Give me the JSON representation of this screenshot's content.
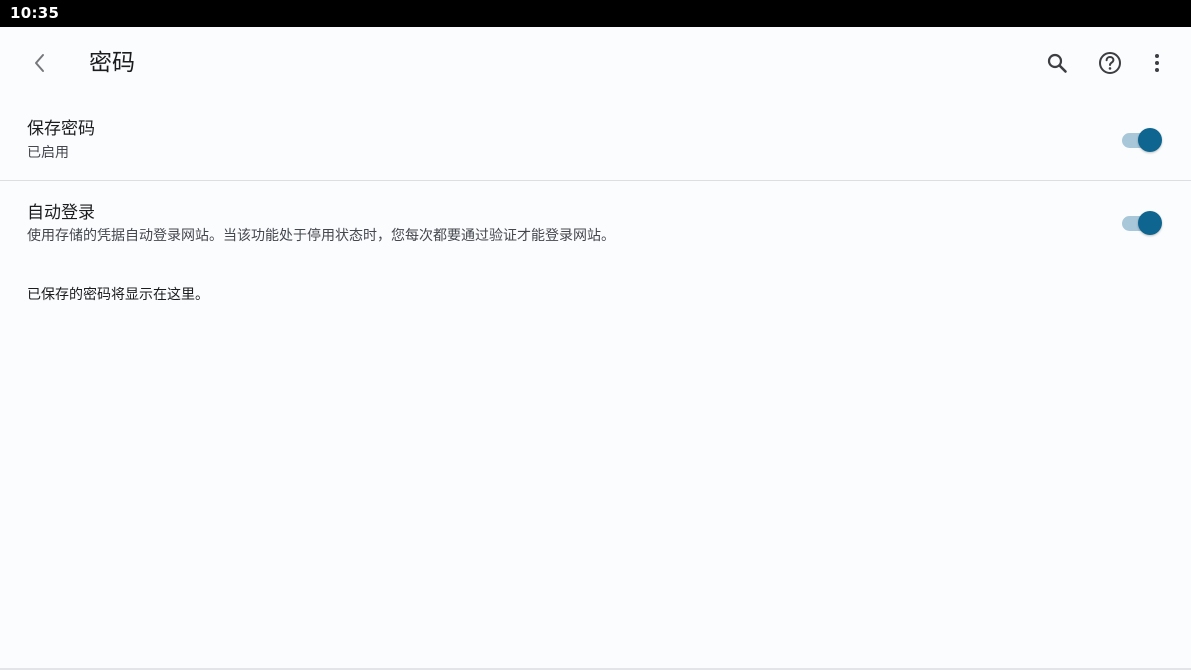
{
  "status_bar": {
    "time": "10:35"
  },
  "toolbar": {
    "title": "密码",
    "icons": {
      "back": "back-arrow-icon",
      "search": "search-icon",
      "help": "help-icon",
      "more": "more-vert-icon"
    }
  },
  "settings": {
    "save_passwords": {
      "title": "保存密码",
      "summary": "已启用",
      "enabled": true
    },
    "auto_signin": {
      "title": "自动登录",
      "summary": "使用存储的凭据自动登录网站。当该功能处于停用状态时，您每次都要通过验证才能登录网站。",
      "enabled": true
    }
  },
  "empty_state": {
    "message": "已保存的密码将显示在这里。"
  },
  "colors": {
    "accent": "#0e6590",
    "track": "#a8c7d9",
    "background": "#fbfcfe",
    "status_bar": "#000000"
  }
}
